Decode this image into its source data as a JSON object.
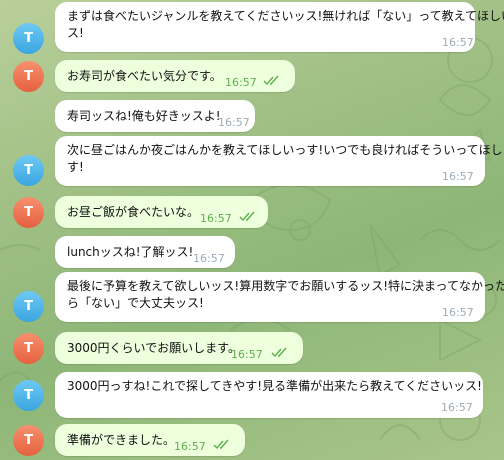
{
  "chat": {
    "messages": [
      {
        "sender_initial": "T",
        "text_lines": [
          "まずは食べたいジャンルを教えてくださいッス!無ければ「ない」って教えてほしいッ",
          "ス!"
        ],
        "time": "16:57"
      },
      {
        "sender_initial": "T",
        "text_lines": [
          "お寿司が食べたい気分です。"
        ],
        "time": "16:57",
        "status": "read"
      },
      {
        "sender_initial": "",
        "text_lines": [
          "寿司ッスね!俺も好きッスよ!"
        ],
        "time": "16:57"
      },
      {
        "sender_initial": "T",
        "text_lines": [
          "次に昼ごはんか夜ごはんかを教えてほしいっす!いつでも良ければそういってほしいっ",
          "す!"
        ],
        "time": "16:57"
      },
      {
        "sender_initial": "T",
        "text_lines": [
          "お昼ご飯が食べたいな。"
        ],
        "time": "16:57",
        "status": "read"
      },
      {
        "sender_initial": "",
        "text_lines": [
          "lunchッスね!了解ッス!"
        ],
        "time": "16:57"
      },
      {
        "sender_initial": "T",
        "text_lines": [
          "最後に予算を教えて欲しいッス!算用数字でお願いするッス!特に決まってなかった",
          "ら「ない」で大丈夫ッス!"
        ],
        "time": "16:57"
      },
      {
        "sender_initial": "T",
        "text_lines": [
          "3000円くらいでお願いします。"
        ],
        "time": "16:57",
        "status": "read"
      },
      {
        "sender_initial": "T",
        "text_lines": [
          "3000円っすね!これで探してきやす!見る準備が出来たら教えてくださいッス!"
        ],
        "time": "16:57"
      },
      {
        "sender_initial": "T",
        "text_lines": [
          "準備ができました。"
        ],
        "time": "16:57",
        "status": "read"
      }
    ]
  },
  "colors": {
    "incoming_bubble": "#ffffff",
    "outgoing_bubble": "#eeffdd",
    "bot_avatar": "#3aa6e0",
    "user_avatar": "#e5613e",
    "read_ticks": "#5fae4e"
  }
}
